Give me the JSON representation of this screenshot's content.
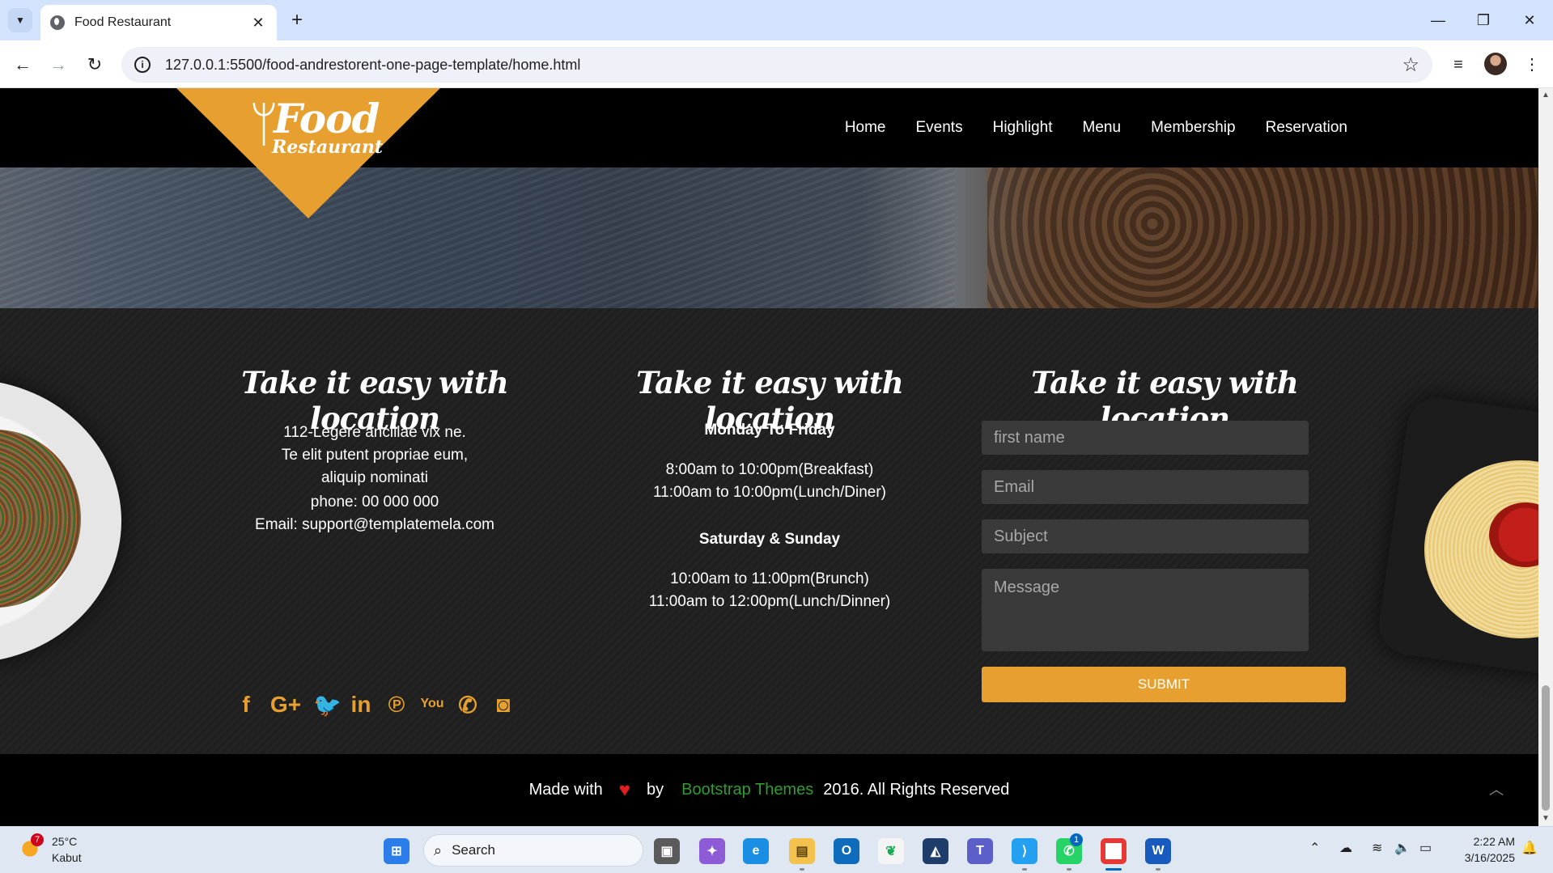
{
  "browser": {
    "tab_title": "Food Restaurant",
    "url": "127.0.0.1:5500/food-andrestorent-one-page-template/home.html"
  },
  "site": {
    "logo_main": "Food",
    "logo_sub": "Restaurant",
    "nav": [
      "Home",
      "Events",
      "Highlight",
      "Menu",
      "Membership",
      "Reservation"
    ]
  },
  "location": {
    "title": "Take it easy with location",
    "address": [
      "112-Legere ancillae vix ne.",
      "Te elit putent propriae eum,",
      "aliquip nominati"
    ],
    "phone": "phone: 00 000 000",
    "email": "Email: support@templatemela.com"
  },
  "hours": {
    "title": "Take it easy with location",
    "weekday_heading": "Monday To Friday",
    "weekday_lines": [
      "8:00am to 10:00pm(Breakfast)",
      "11:00am to 10:00pm(Lunch/Diner)"
    ],
    "weekend_heading": "Saturday & Sunday",
    "weekend_lines": [
      "10:00am to 11:00pm(Brunch)",
      "11:00am to 12:00pm(Lunch/Dinner)"
    ]
  },
  "contact_form": {
    "title": "Take it easy with location",
    "first_name_placeholder": "first name",
    "email_placeholder": "Email",
    "subject_placeholder": "Subject",
    "message_placeholder": "Message",
    "submit_label": "SUBMIT"
  },
  "social_icons": [
    "facebook-icon",
    "google-plus-icon",
    "twitter-icon",
    "linkedin-icon",
    "pinterest-icon",
    "youtube-icon",
    "phone-icon",
    "camera-icon"
  ],
  "footer": {
    "made_with": "Made with",
    "by": "by",
    "brand": "Bootstrap Themes",
    "rights": "2016. All Rights Reserved"
  },
  "taskbar": {
    "weather_temp": "25°C",
    "weather_condition": "Kabut",
    "weather_badge": "7",
    "search_placeholder": "Search",
    "whatsapp_badge": "1",
    "time": "2:22 AM",
    "date": "3/16/2025"
  },
  "colors": {
    "accent": "#e7a02f",
    "brand_link": "#2e9d2e",
    "heart": "#e02020"
  }
}
